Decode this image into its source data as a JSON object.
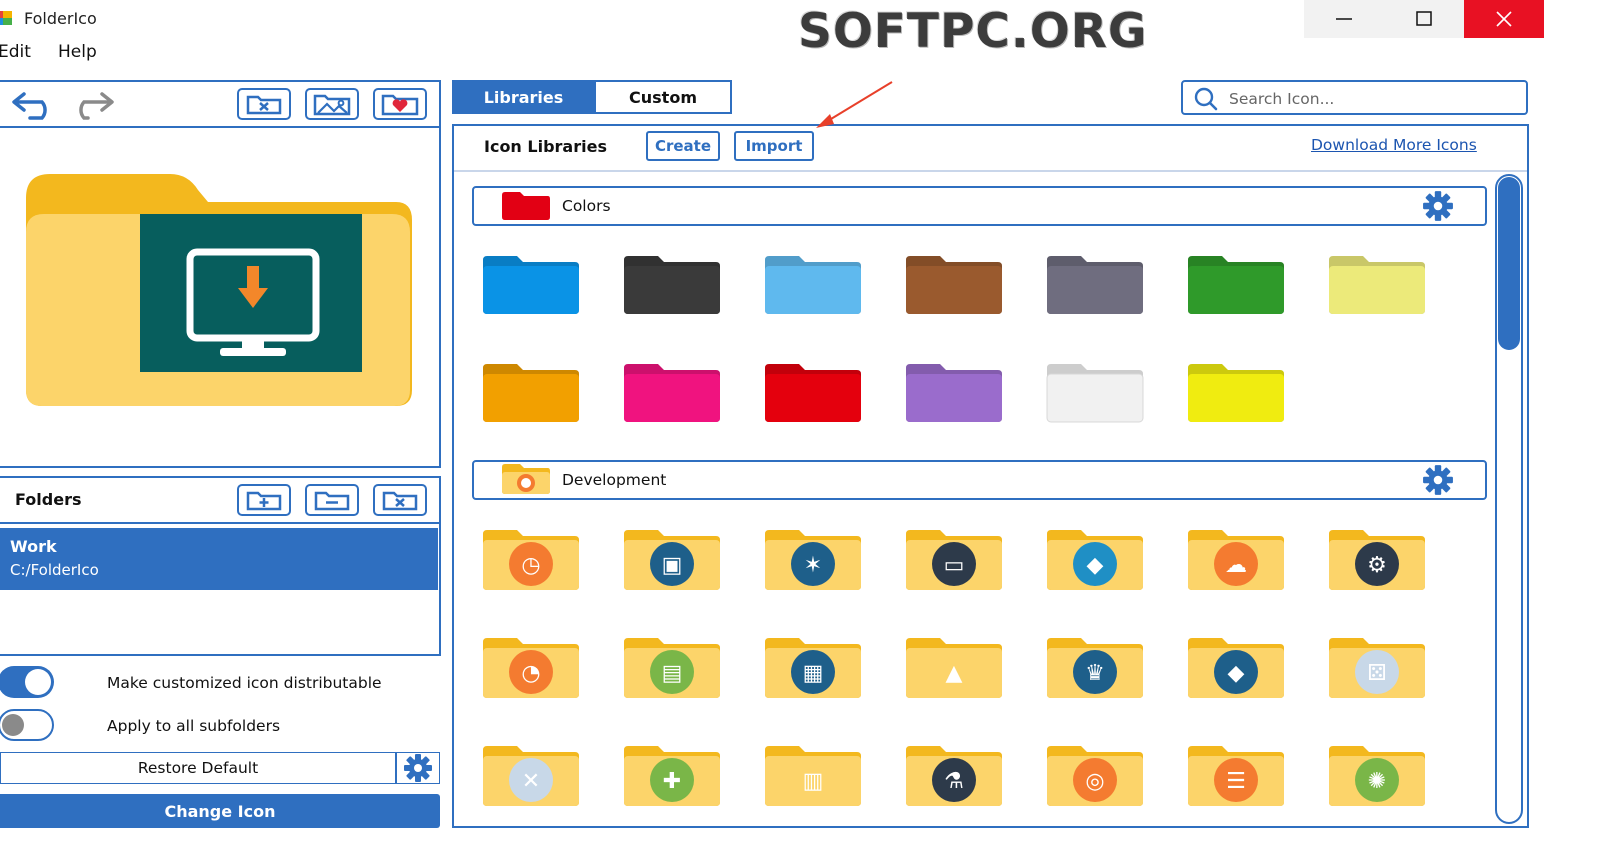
{
  "window": {
    "title": "FolderIco",
    "watermark": "SOFTPC.ORG"
  },
  "menu": {
    "edit": "Edit",
    "help": "Help"
  },
  "left": {
    "folders_label": "Folders",
    "folder_item": {
      "name": "Work",
      "path": "C:/FolderIco"
    },
    "toggle_distributable": {
      "label": "Make customized icon distributable",
      "on": true
    },
    "toggle_subfolders": {
      "label": "Apply to all subfolders",
      "on": false
    },
    "restore_default": "Restore Default",
    "change_icon": "Change Icon"
  },
  "tabs": {
    "libraries": "Libraries",
    "custom": "Custom",
    "active": "Libraries"
  },
  "search": {
    "placeholder": "Search Icon..."
  },
  "libraries": {
    "heading": "Icon Libraries",
    "create": "Create",
    "import": "Import",
    "download_more": "Download More Icons",
    "sections": [
      {
        "name": "Colors"
      },
      {
        "name": "Development"
      }
    ]
  },
  "colors": {
    "accent": "#2f6fc0",
    "folder_colors_row1": [
      "#0a93e6",
      "#3a3a3a",
      "#5fb9ee",
      "#9a5a2e",
      "#6f6d7f",
      "#2f9a2a",
      "#ecea7a"
    ],
    "folder_colors_row2": [
      "#f2a000",
      "#f0137f",
      "#e4000d",
      "#9a6ccc",
      "#f1f1f1",
      "#f0ec10"
    ]
  },
  "dev_icons": [
    [
      "alarm-clock-icon",
      "package-icon",
      "compass-star-icon",
      "browser-window-icon",
      "tag-icon",
      "cloud-icon",
      "gear-icon"
    ],
    [
      "stopwatch-icon",
      "monitor-code-icon",
      "presentation-icon",
      "traffic-cone-icon",
      "crown-icon",
      "diamond-icon",
      "dice-icon"
    ],
    [
      "tools-icon",
      "puzzle-icon",
      "brick-fire-icon",
      "flask-icon",
      "gamepad-icon",
      "sitemap-icon",
      "bug-icon"
    ]
  ]
}
